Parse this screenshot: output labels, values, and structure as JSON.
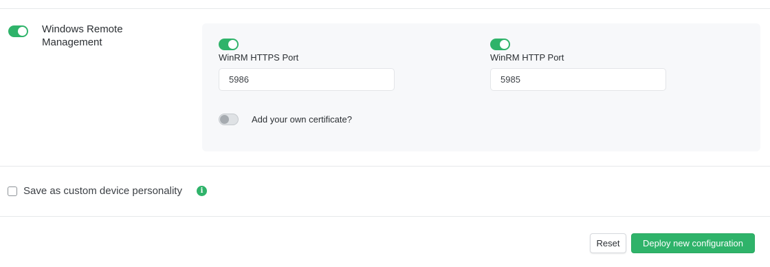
{
  "colors": {
    "accent": "#2fb36a",
    "panel_bg": "#f7f8fa",
    "divider": "#e6e8ea"
  },
  "winrm": {
    "title": "Windows Remote Management",
    "enabled": true,
    "https": {
      "enabled": true,
      "label": "WinRM HTTPS Port",
      "value": "5986"
    },
    "http": {
      "enabled": true,
      "label": "WinRM HTTP Port",
      "value": "5985"
    },
    "certificate": {
      "enabled": false,
      "label": "Add your own certificate?"
    }
  },
  "personality": {
    "checked": false,
    "label": "Save as custom device personality",
    "info_icon": "info-icon"
  },
  "actions": {
    "reset_label": "Reset",
    "deploy_label": "Deploy new configuration"
  }
}
